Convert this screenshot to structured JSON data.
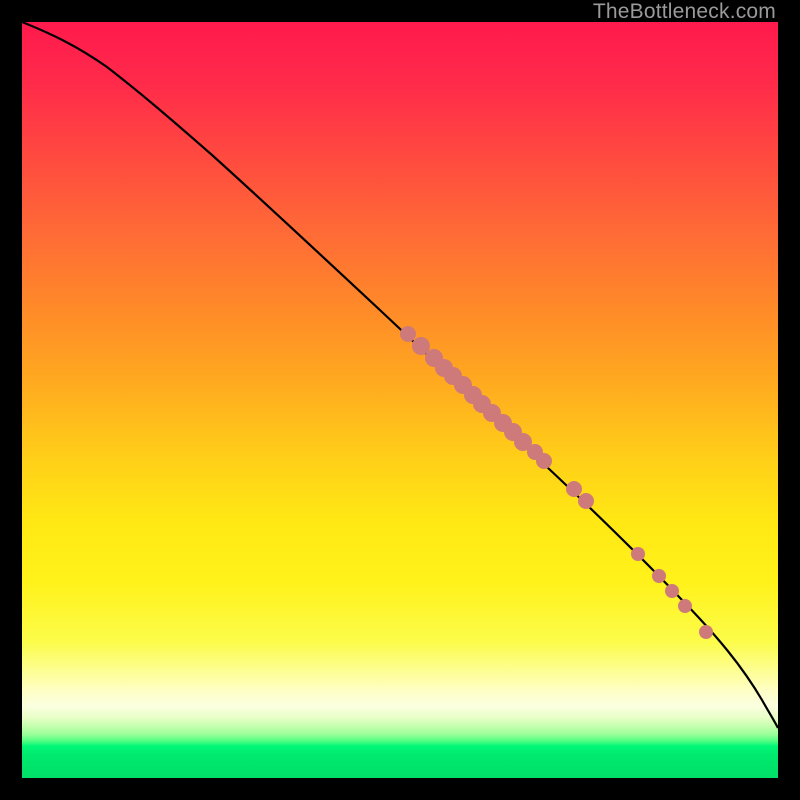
{
  "watermark": "TheBottleneck.com",
  "chart_data": {
    "type": "line",
    "title": "",
    "xlabel": "",
    "ylabel": "",
    "xlim": [
      0,
      100
    ],
    "ylim": [
      0,
      100
    ],
    "grid": false,
    "legend": false,
    "background_gradient": [
      "#ff1a4d",
      "#ff8a28",
      "#ffe814",
      "#feffc6",
      "#00e069"
    ],
    "series": [
      {
        "name": "curve",
        "type": "line",
        "color": "#000000",
        "x": [
          0,
          4,
          8,
          12,
          16,
          20,
          26,
          32,
          40,
          48,
          56,
          64,
          72,
          80,
          86,
          91,
          95,
          98,
          100
        ],
        "y": [
          100,
          98.5,
          96.5,
          94,
          91,
          88,
          82.5,
          77,
          69,
          61.5,
          54,
          46.5,
          39,
          31,
          24.5,
          18.5,
          13.5,
          9.5,
          7
        ]
      },
      {
        "name": "cluster-upper",
        "type": "scatter",
        "color": "#cf7a7a",
        "marker_radius": 8,
        "x": [
          51,
          52.8,
          54.5,
          55.8,
          57.0,
          58.3,
          59.6,
          60.9,
          62.2,
          63.6,
          64.9,
          66.3,
          67.8,
          69.0,
          73.0,
          74.6
        ],
        "y": [
          58.7,
          57.1,
          55.5,
          54.3,
          53.2,
          51.9,
          50.7,
          49.5,
          48.3,
          47.0,
          45.8,
          44.5,
          43.1,
          42.0,
          38.2,
          36.7
        ]
      },
      {
        "name": "cluster-lower",
        "type": "scatter",
        "color": "#cf7a7a",
        "marker_radius": 7,
        "x": [
          81.5,
          84.2,
          86.0,
          87.7,
          90.5
        ],
        "y": [
          29.6,
          26.7,
          24.8,
          22.8,
          19.3
        ]
      }
    ]
  }
}
